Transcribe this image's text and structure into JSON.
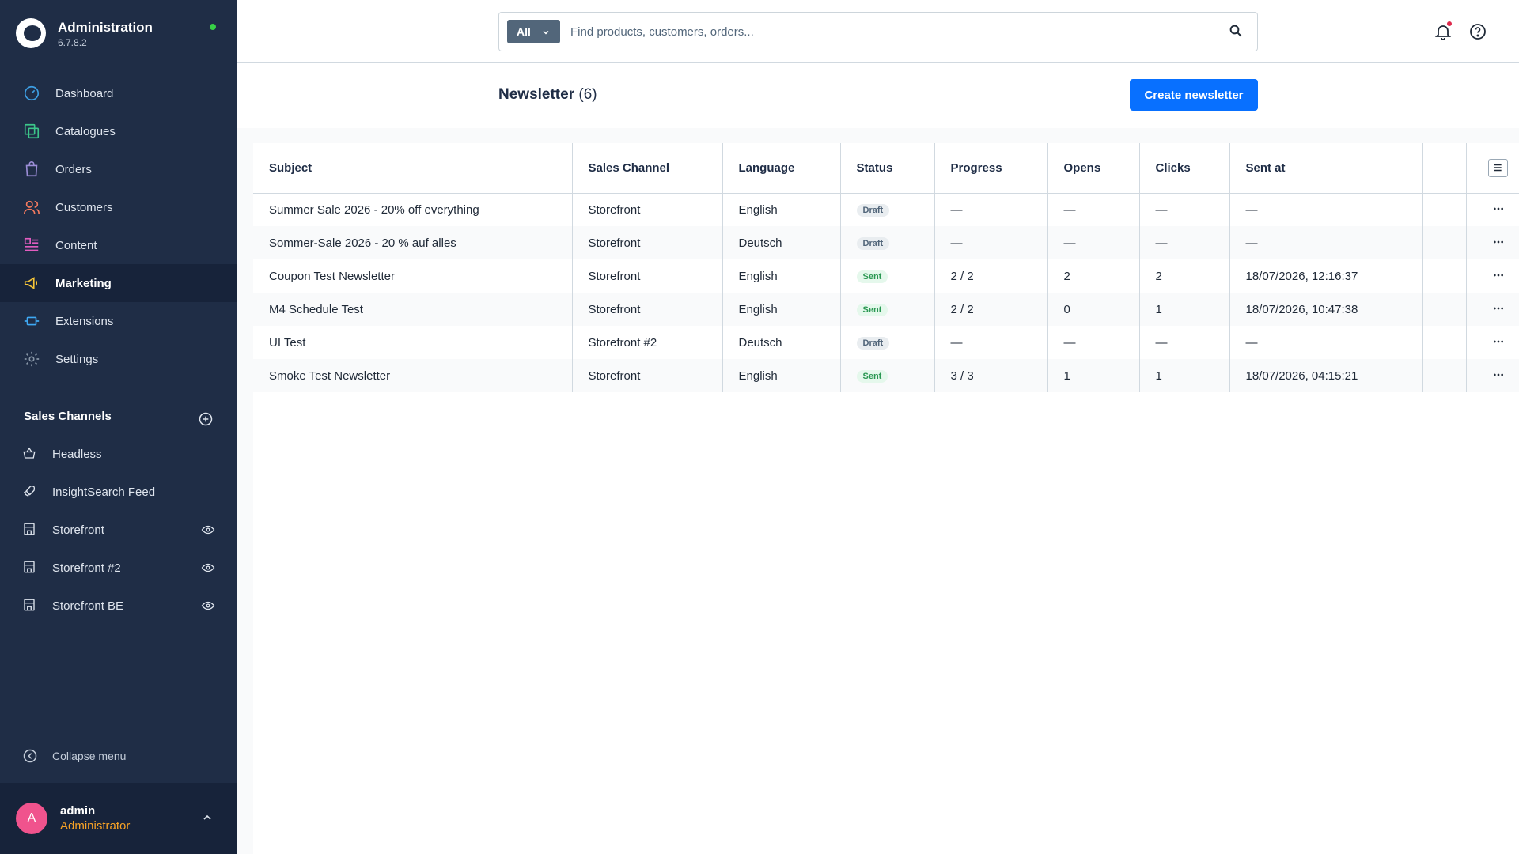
{
  "app": {
    "title": "Administration",
    "version": "6.7.8.2"
  },
  "nav": {
    "items": [
      {
        "label": "Dashboard",
        "icon": "dashboard-icon"
      },
      {
        "label": "Catalogues",
        "icon": "catalogues-icon"
      },
      {
        "label": "Orders",
        "icon": "orders-icon"
      },
      {
        "label": "Customers",
        "icon": "customers-icon"
      },
      {
        "label": "Content",
        "icon": "content-icon"
      },
      {
        "label": "Marketing",
        "icon": "marketing-icon"
      },
      {
        "label": "Extensions",
        "icon": "extensions-icon"
      },
      {
        "label": "Settings",
        "icon": "settings-icon"
      }
    ]
  },
  "sales_channels": {
    "header": "Sales Channels",
    "items": [
      {
        "label": "Headless",
        "icon": "basket-icon"
      },
      {
        "label": "InsightSearch Feed",
        "icon": "rocket-icon"
      },
      {
        "label": "Storefront",
        "icon": "storefront-icon"
      },
      {
        "label": "Storefront #2",
        "icon": "storefront-icon"
      },
      {
        "label": "Storefront BE",
        "icon": "storefront-icon"
      }
    ]
  },
  "sidebar": {
    "collapse_label": "Collapse menu"
  },
  "user": {
    "initial": "A",
    "name": "admin",
    "role": "Administrator"
  },
  "search": {
    "filter_label": "All",
    "placeholder": "Find products, customers, orders..."
  },
  "page": {
    "title": "Newsletter",
    "count": "(6)",
    "create_label": "Create newsletter"
  },
  "table": {
    "columns": [
      "Subject",
      "Sales Channel",
      "Language",
      "Status",
      "Progress",
      "Opens",
      "Clicks",
      "Sent at"
    ],
    "rows": [
      {
        "subject": "Summer Sale 2026 - 20% off everything",
        "channel": "Storefront",
        "language": "English",
        "status": "Draft",
        "progress": "—",
        "opens": "—",
        "clicks": "—",
        "sent_at": "—"
      },
      {
        "subject": "Sommer-Sale 2026 - 20 % auf alles",
        "channel": "Storefront",
        "language": "Deutsch",
        "status": "Draft",
        "progress": "—",
        "opens": "—",
        "clicks": "—",
        "sent_at": "—"
      },
      {
        "subject": "Coupon Test Newsletter",
        "channel": "Storefront",
        "language": "English",
        "status": "Sent",
        "progress": "2 / 2",
        "opens": "2",
        "clicks": "2",
        "sent_at": "18/07/2026, 12:16:37"
      },
      {
        "subject": "M4 Schedule Test",
        "channel": "Storefront",
        "language": "English",
        "status": "Sent",
        "progress": "2 / 2",
        "opens": "0",
        "clicks": "1",
        "sent_at": "18/07/2026, 10:47:38"
      },
      {
        "subject": "UI Test",
        "channel": "Storefront #2",
        "language": "Deutsch",
        "status": "Draft",
        "progress": "—",
        "opens": "—",
        "clicks": "—",
        "sent_at": "—"
      },
      {
        "subject": "Smoke Test Newsletter",
        "channel": "Storefront",
        "language": "English",
        "status": "Sent",
        "progress": "3 / 3",
        "opens": "1",
        "clicks": "1",
        "sent_at": "18/07/2026, 04:15:21"
      }
    ]
  },
  "colors": {
    "sidebar_bg": "#1f2d46",
    "primary": "#0870ff",
    "sent": "#2a9852",
    "draft": "#52667a"
  }
}
